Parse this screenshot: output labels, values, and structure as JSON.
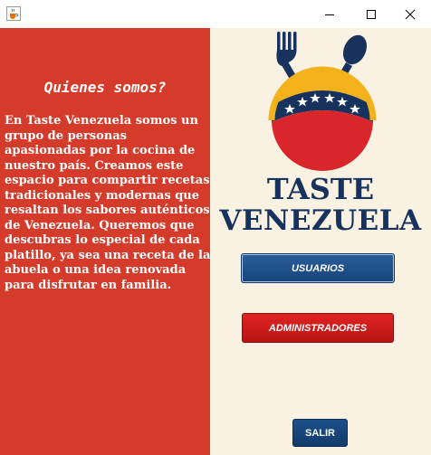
{
  "window": {
    "icon": "java-cup-icon",
    "controls": [
      "minimize-icon",
      "maximize-icon",
      "close-icon"
    ]
  },
  "about": {
    "title": "Quienes somos?",
    "text": "En Taste Venezuela somos un grupo de personas apasionadas por la cocina de nuestro país. Creamos este espacio para compartir recetas tradicionales y modernas que resaltan los sabores auténticos de Venezuela. Queremos que descubras lo especial de cada platillo, ya sea una receta de la abuela o una idea renovada para disfrutar en familia."
  },
  "logo": {
    "line1": "TASTE",
    "line2": "VENEZUELA",
    "icon": "fork-spoon-flag-emblem",
    "colors": {
      "blue": "#17325c",
      "yellow": "#f3b21b",
      "red": "#d9262b"
    }
  },
  "buttons": {
    "usuarios": "USUARIOS",
    "administradores": "ADMINISTRADORES",
    "salir": "SALIR"
  },
  "colors": {
    "left_panel": "#d43b2a",
    "right_panel": "#f9f1e2",
    "button_blue": "#1d4f88",
    "button_red": "#c91b1b"
  }
}
